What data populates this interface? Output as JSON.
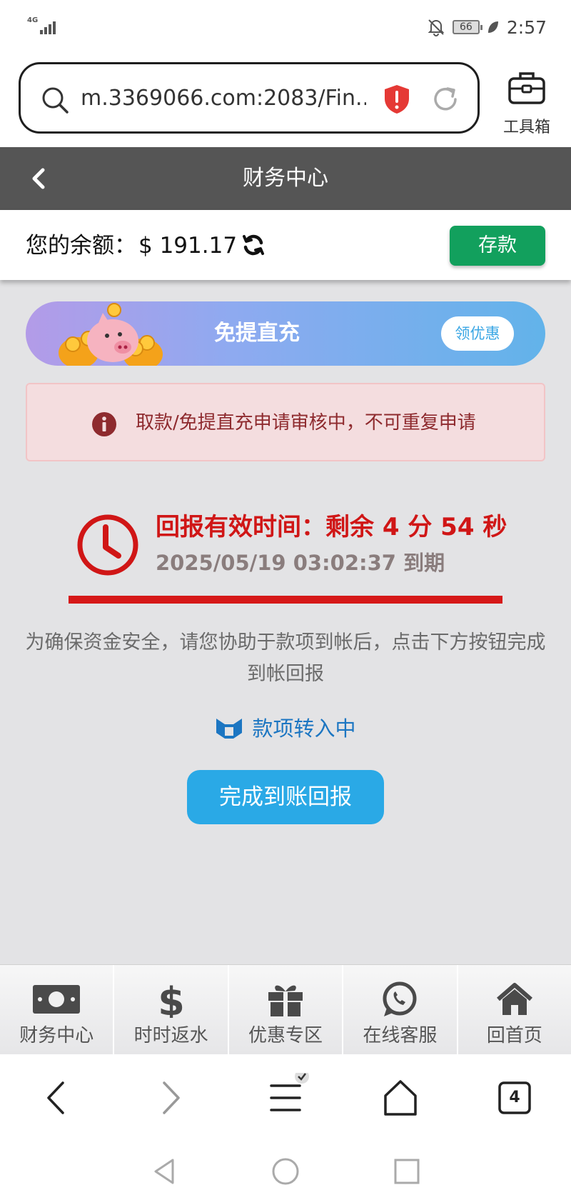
{
  "statusbar": {
    "network": "4G",
    "battery": "66",
    "time": "2:57"
  },
  "browser": {
    "url": "m.3369066.com:2083/Fin...",
    "toolbox_label": "工具箱"
  },
  "page": {
    "title": "财务中心"
  },
  "balance": {
    "label": "您的余额：",
    "amount": "$ 191.17",
    "deposit_label": "存款"
  },
  "promo": {
    "title": "免提直充",
    "claim_label": "领优惠"
  },
  "alert": {
    "message": "取款/免提直充申请审核中，不可重复申请"
  },
  "timer": {
    "title": "回报有效时间：剩余 4 分 54 秒",
    "expiry": "2025/05/19 03:02:37 到期"
  },
  "notice": "为确保资金安全，请您协助于款项到帐后，点击下方按钮完成到帐回报",
  "transfer_status": "款项转入中",
  "report_button": "完成到账回报",
  "app_nav": [
    {
      "label": "财务中心",
      "icon": "money-bill-icon"
    },
    {
      "label": "时时返水",
      "icon": "dollar-icon"
    },
    {
      "label": "优惠专区",
      "icon": "gift-icon"
    },
    {
      "label": "在线客服",
      "icon": "whatsapp-icon"
    },
    {
      "label": "回首页",
      "icon": "home-icon"
    }
  ],
  "browser_toolbar": {
    "tab_count": "4"
  },
  "colors": {
    "header_bg": "#555555",
    "deposit_green": "#12a05d",
    "alert_red": "#d01616",
    "button_blue": "#2aa9e6",
    "link_blue": "#1c76c2"
  }
}
